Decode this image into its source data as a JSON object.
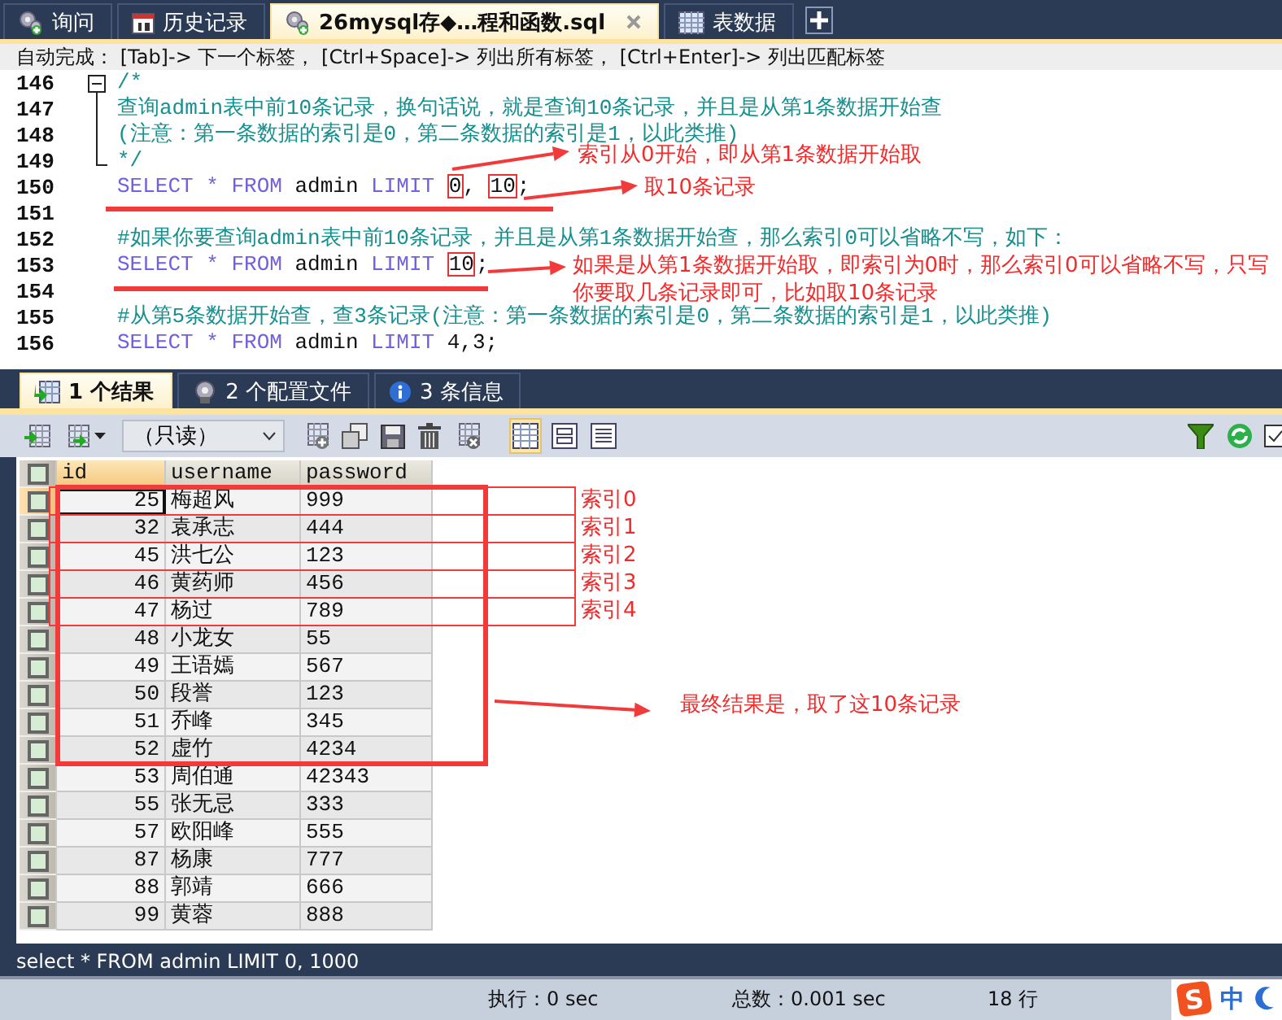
{
  "tabs": [
    {
      "label": "询问",
      "kind": "query",
      "selected": false
    },
    {
      "label": "历史记录",
      "kind": "history",
      "selected": false
    },
    {
      "label": "26mysql存◆…程和函数.sql",
      "kind": "sql",
      "selected": true
    },
    {
      "label": "表数据",
      "kind": "table",
      "selected": false
    }
  ],
  "hint_bar": "自动完成： [Tab]-> 下一个标签， [Ctrl+Space]-> 列出所有标签， [Ctrl+Enter]-> 列出匹配标签",
  "editor": {
    "lines": [
      {
        "number": "146",
        "kind": "fold_start",
        "tokens": [
          {
            "text": "/*",
            "kind": "comment"
          }
        ]
      },
      {
        "number": "147",
        "kind": "fold_body",
        "tokens": [
          {
            "text": "查询admin表中前10条记录，换句话说，就是查询10条记录，并且是从第1条数据开始查",
            "kind": "comment"
          }
        ]
      },
      {
        "number": "148",
        "kind": "fold_body",
        "tokens": [
          {
            "text": "(注意：第一条数据的索引是0，第二条数据的索引是1，以此类推)",
            "kind": "comment"
          }
        ]
      },
      {
        "number": "149",
        "kind": "fold_end",
        "tokens": [
          {
            "text": "*/",
            "kind": "comment"
          }
        ]
      },
      {
        "number": "150",
        "kind": "code",
        "tokens": [
          {
            "text": "SELECT",
            "kind": "keyword"
          },
          {
            "text": " * ",
            "kind": "operator"
          },
          {
            "text": "FROM",
            "kind": "keyword"
          },
          {
            "text": " admin ",
            "kind": "plain"
          },
          {
            "text": "LIMIT ",
            "kind": "keyword"
          },
          {
            "text": "0",
            "kind": "highlight"
          },
          {
            "text": ", ",
            "kind": "plain"
          },
          {
            "text": "10",
            "kind": "highlight"
          },
          {
            "text": ";",
            "kind": "plain"
          }
        ]
      },
      {
        "number": "151",
        "kind": "code"
      },
      {
        "number": "152",
        "kind": "code",
        "tokens": [
          {
            "text": "#如果你要查询admin表中前10条记录，并且是从第1条数据开始查，那么索引0可以省略不写，如下：",
            "kind": "comment"
          }
        ]
      },
      {
        "number": "153",
        "kind": "code",
        "tokens": [
          {
            "text": "SELECT",
            "kind": "keyword"
          },
          {
            "text": " * ",
            "kind": "operator"
          },
          {
            "text": "FROM",
            "kind": "keyword"
          },
          {
            "text": " admin ",
            "kind": "plain"
          },
          {
            "text": "LIMIT ",
            "kind": "keyword"
          },
          {
            "text": "10",
            "kind": "highlight"
          },
          {
            "text": ";",
            "kind": "plain"
          }
        ]
      },
      {
        "number": "154",
        "kind": "code"
      },
      {
        "number": "155",
        "kind": "code",
        "tokens": [
          {
            "text": "#从第5条数据开始查，查3条记录(注意：第一条数据的索引是0，第二条数据的索引是1，以此类推)",
            "kind": "comment"
          }
        ]
      },
      {
        "number": "156",
        "kind": "code",
        "tokens": [
          {
            "text": "SELECT",
            "kind": "keyword"
          },
          {
            "text": " * ",
            "kind": "operator"
          },
          {
            "text": "FROM",
            "kind": "keyword"
          },
          {
            "text": " admin ",
            "kind": "plain"
          },
          {
            "text": "LIMIT",
            "kind": "keyword"
          },
          {
            "text": " 4,3;",
            "kind": "plain"
          }
        ]
      }
    ],
    "annotations": [
      {
        "text": "索引从0开始，即从第1条数据开始取"
      },
      {
        "text": "取10条记录"
      },
      {
        "text": "如果是从第1条数据开始取，即索引为0时，那么索引0可以省略不写，只写你要取几条记录即可，比如取10条记录"
      }
    ]
  },
  "results": {
    "tabs": [
      {
        "label": "1 个结果",
        "kind": "result",
        "selected": true
      },
      {
        "label": "2 个配置文件",
        "kind": "profile",
        "selected": false
      },
      {
        "label": "3 条信息",
        "kind": "info",
        "selected": false
      }
    ],
    "mode_select": "（只读）",
    "all_checked": false,
    "columns": [
      {
        "label": "id",
        "selected": true
      },
      {
        "label": "username",
        "selected": false
      },
      {
        "label": "password",
        "selected": false
      }
    ],
    "rows": [
      {
        "cells": [
          "25",
          "梅超风",
          "999"
        ],
        "selected": true,
        "boxed": true,
        "index_label": "索引0"
      },
      {
        "cells": [
          "32",
          "袁承志",
          "444"
        ],
        "selected": false,
        "boxed": true,
        "index_label": "索引1"
      },
      {
        "cells": [
          "45",
          "洪七公",
          "123"
        ],
        "selected": false,
        "boxed": true,
        "index_label": "索引2"
      },
      {
        "cells": [
          "46",
          "黄药师",
          "456"
        ],
        "selected": false,
        "boxed": true,
        "index_label": "索引3"
      },
      {
        "cells": [
          "47",
          "杨过",
          "789"
        ],
        "selected": false,
        "boxed": true,
        "index_label": "索引4"
      },
      {
        "cells": [
          "48",
          "小龙女",
          "55"
        ],
        "selected": false,
        "boxed": true
      },
      {
        "cells": [
          "49",
          "王语嫣",
          "567"
        ],
        "selected": false,
        "boxed": true
      },
      {
        "cells": [
          "50",
          "段誉",
          "123"
        ],
        "selected": false,
        "boxed": true
      },
      {
        "cells": [
          "51",
          "乔峰",
          "345"
        ],
        "selected": false,
        "boxed": true
      },
      {
        "cells": [
          "52",
          "虚竹",
          "4234"
        ],
        "selected": false,
        "boxed": true
      },
      {
        "cells": [
          "53",
          "周伯通",
          "42343"
        ],
        "selected": false,
        "boxed": false
      },
      {
        "cells": [
          "55",
          "张无忌",
          "333"
        ],
        "selected": false,
        "boxed": false
      },
      {
        "cells": [
          "57",
          "欧阳峰",
          "555"
        ],
        "selected": false,
        "boxed": false
      },
      {
        "cells": [
          "87",
          "杨康",
          "777"
        ],
        "selected": false,
        "boxed": false
      },
      {
        "cells": [
          "88",
          "郭靖",
          "666"
        ],
        "selected": false,
        "boxed": false
      },
      {
        "cells": [
          "99",
          "黄蓉",
          "888"
        ],
        "selected": false,
        "boxed": false
      }
    ],
    "note": "最终结果是，取了这10条记录"
  },
  "status_bar": {
    "query": "select * FROM admin LIMIT 0, 1000",
    "exec_time": "执行：0 sec",
    "total_time": "总数：0.001 sec",
    "row_count": "18 行"
  },
  "ime": {
    "logo": "S",
    "mode": "中"
  }
}
